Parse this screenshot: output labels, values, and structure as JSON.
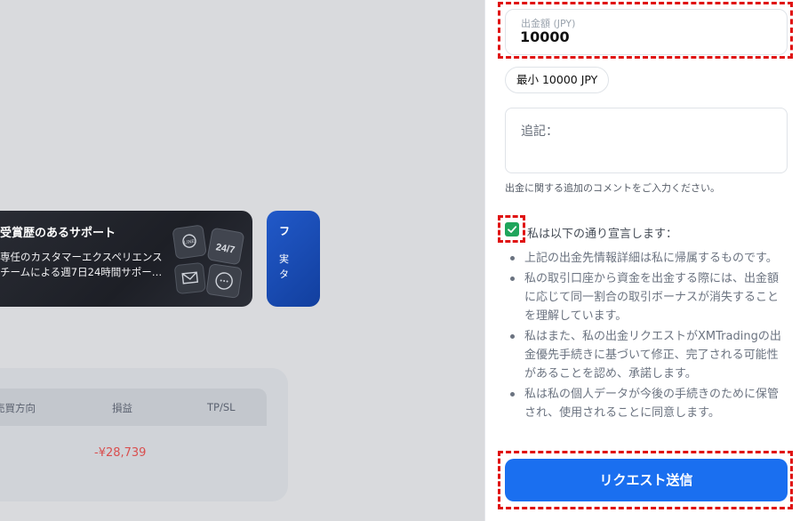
{
  "promo": {
    "title": "受賞歴のあるサポート",
    "desc_line1": "専任のカスタマーエクスペリエンス",
    "desc_line2": "チームによる週7日24時間サポー…",
    "badge_24_7": "24/7",
    "badge_line": "LINE"
  },
  "promo2": {
    "title": "フ",
    "desc_line1": "実",
    "desc_line2": "タ"
  },
  "positions": {
    "columns": [
      "売買方向",
      "損益",
      "TP/SL"
    ],
    "pnl_value": "-¥28,739"
  },
  "withdrawal": {
    "amount_label": "出金額 (JPY)",
    "amount_value": "10000",
    "min_chip": "最小 10000 JPY",
    "note_placeholder": "追記：",
    "note_help": "出金に関する追加のコメントをご入力ください。",
    "declaration": "私は以下の通り宣言します：",
    "terms": [
      "上記の出金先情報詳細は私に帰属するものです。",
      "私の取引口座から資金を出金する際には、出金額に応じて同一割合の取引ボーナスが消失することを理解しています。",
      "私はまた、私の出金リクエストがXMTradingの出金優先手続きに基づいて修正、完了される可能性があることを認め、承諾します。",
      "私は私の個人データが今後の手続きのために保管され、使用されることに同意します。"
    ],
    "submit_label": "リクエスト送信",
    "checkbox_checked": true
  },
  "colors": {
    "accent_blue": "#1a6ff0",
    "check_green": "#1fa55b",
    "loss_red": "#d94f4f",
    "highlight_red": "#e01313"
  }
}
